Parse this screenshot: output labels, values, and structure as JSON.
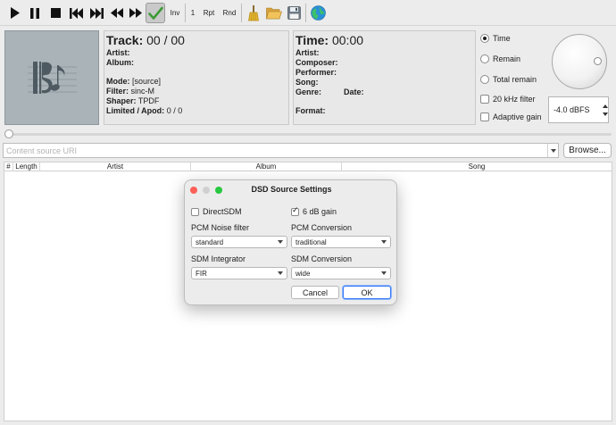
{
  "toolbar": {
    "inv_label": "Inv",
    "track_num_label": "1",
    "repeat_label": "Rpt",
    "random_label": "Rnd"
  },
  "track_panel": {
    "heading": "Track:",
    "counter": "00 / 00",
    "artist_label": "Artist:",
    "album_label": "Album:",
    "mode_label": "Mode:",
    "mode_value": "[source]",
    "filter_label": "Filter:",
    "filter_value": "sinc-M",
    "shaper_label": "Shaper:",
    "shaper_value": "TPDF",
    "limited_label": "Limited / Apod:",
    "limited_value": "0 / 0"
  },
  "time_panel": {
    "heading": "Time:",
    "time_value": "00:00",
    "artist_label": "Artist:",
    "composer_label": "Composer:",
    "performer_label": "Performer:",
    "song_label": "Song:",
    "genre_label": "Genre:",
    "date_label": "Date:",
    "format_label": "Format:"
  },
  "display_options": {
    "time_label": "Time",
    "remain_label": "Remain",
    "total_remain_label": "Total remain",
    "selected": "Time",
    "khz_label": "20 kHz filter",
    "adaptive_label": "Adaptive gain",
    "volume_value": "-4.0 dBFS"
  },
  "source": {
    "uri_placeholder": "Content source URI",
    "browse_label": "Browse..."
  },
  "playlist": {
    "columns": [
      "#",
      "Length",
      "Artist",
      "Album",
      "Song"
    ],
    "rows": []
  },
  "dialog": {
    "title": "DSD Source Settings",
    "direct_sdm_label": "DirectSDM",
    "direct_sdm_checked": false,
    "gain_label": "6 dB gain",
    "gain_checked": true,
    "pcm_noise_label": "PCM Noise filter",
    "pcm_noise_value": "standard",
    "pcm_conv_label": "PCM Conversion",
    "pcm_conv_value": "traditional",
    "sdm_int_label": "SDM Integrator",
    "sdm_int_value": "FIR",
    "sdm_conv_label": "SDM Conversion",
    "sdm_conv_value": "wide",
    "cancel_label": "Cancel",
    "ok_label": "OK"
  },
  "colors": {
    "accent_blue": "#3478f6",
    "check_green": "#3d9b35",
    "close_red": "#ff5f57",
    "minimize_gray": "#d0d0d0",
    "zoom_green": "#28c840"
  }
}
